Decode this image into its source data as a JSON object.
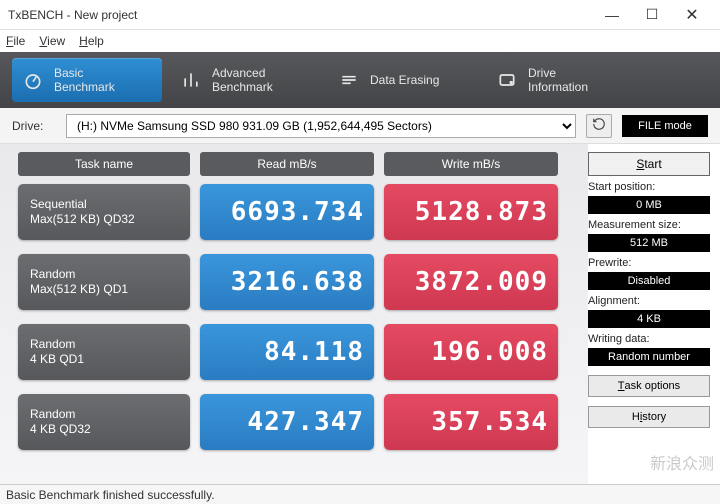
{
  "window": {
    "title": "TxBENCH - New project"
  },
  "menu": {
    "file": "File",
    "view": "View",
    "help": "Help"
  },
  "tabs": {
    "basic": {
      "l1": "Basic",
      "l2": "Benchmark"
    },
    "advanced": {
      "l1": "Advanced",
      "l2": "Benchmark"
    },
    "erasing": {
      "l1": "Data Erasing"
    },
    "driveinfo": {
      "l1": "Drive",
      "l2": "Information"
    }
  },
  "drive": {
    "label": "Drive:",
    "selected": "(H:) NVMe Samsung SSD 980  931.09 GB (1,952,644,495 Sectors)",
    "filemode": "FILE mode"
  },
  "headers": {
    "task": "Task name",
    "read": "Read mB/s",
    "write": "Write mB/s"
  },
  "rows": [
    {
      "name1": "Sequential",
      "name2": "Max(512 KB) QD32",
      "read": "6693.734",
      "write": "5128.873"
    },
    {
      "name1": "Random",
      "name2": "Max(512 KB) QD1",
      "read": "3216.638",
      "write": "3872.009"
    },
    {
      "name1": "Random",
      "name2": "4 KB QD1",
      "read": "84.118",
      "write": "196.008"
    },
    {
      "name1": "Random",
      "name2": "4 KB QD32",
      "read": "427.347",
      "write": "357.534"
    }
  ],
  "side": {
    "start": "Start",
    "startpos_l": "Start position:",
    "startpos_v": "0 MB",
    "msize_l": "Measurement size:",
    "msize_v": "512 MB",
    "prewrite_l": "Prewrite:",
    "prewrite_v": "Disabled",
    "align_l": "Alignment:",
    "align_v": "4 KB",
    "wdata_l": "Writing data:",
    "wdata_v": "Random number",
    "taskopt": "Task options",
    "history": "History"
  },
  "status": "Basic Benchmark finished successfully.",
  "watermark": "新浪众测",
  "chart_data": {
    "type": "table",
    "title": "TxBENCH Basic Benchmark Results",
    "columns": [
      "Task name",
      "Read MB/s",
      "Write MB/s"
    ],
    "rows": [
      [
        "Sequential Max(512 KB) QD32",
        6693.734,
        5128.873
      ],
      [
        "Random Max(512 KB) QD1",
        3216.638,
        3872.009
      ],
      [
        "Random 4 KB QD1",
        84.118,
        196.008
      ],
      [
        "Random 4 KB QD32",
        427.347,
        357.534
      ]
    ],
    "drive": "(H:) NVMe Samsung SSD 980 931.09 GB",
    "measurement_size": "512 MB"
  }
}
